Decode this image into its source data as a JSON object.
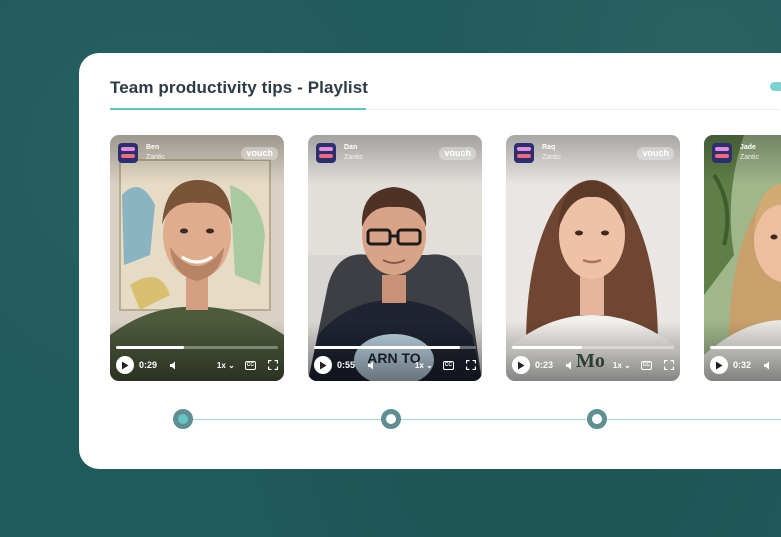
{
  "playlist": {
    "title": "Team productivity tips - Playlist"
  },
  "videos": [
    {
      "name": "Ben",
      "company": "Zantic",
      "badge": "vouch",
      "time": "0:29",
      "speed": "1x",
      "cc": "CC",
      "progress": 0.42
    },
    {
      "name": "Dan",
      "company": "Zantic",
      "badge": "vouch",
      "time": "0:55",
      "speed": "1x",
      "cc": "CC",
      "progress": 0.9
    },
    {
      "name": "Raq",
      "company": "Zantic",
      "badge": "vouch",
      "time": "0:23",
      "speed": "1x",
      "cc": "CC",
      "progress": 0.43
    },
    {
      "name": "Jade",
      "company": "Zantic",
      "badge": "vouch",
      "time": "0:32",
      "speed": "1x",
      "cc": "CC",
      "progress": 0.62
    }
  ],
  "timeline": {
    "active_index": 0
  },
  "colors": {
    "background": "#1f5a5c",
    "accent": "#5fc4c4",
    "timeline_node": "#5f8f93",
    "logo": "#2a2f6f"
  }
}
